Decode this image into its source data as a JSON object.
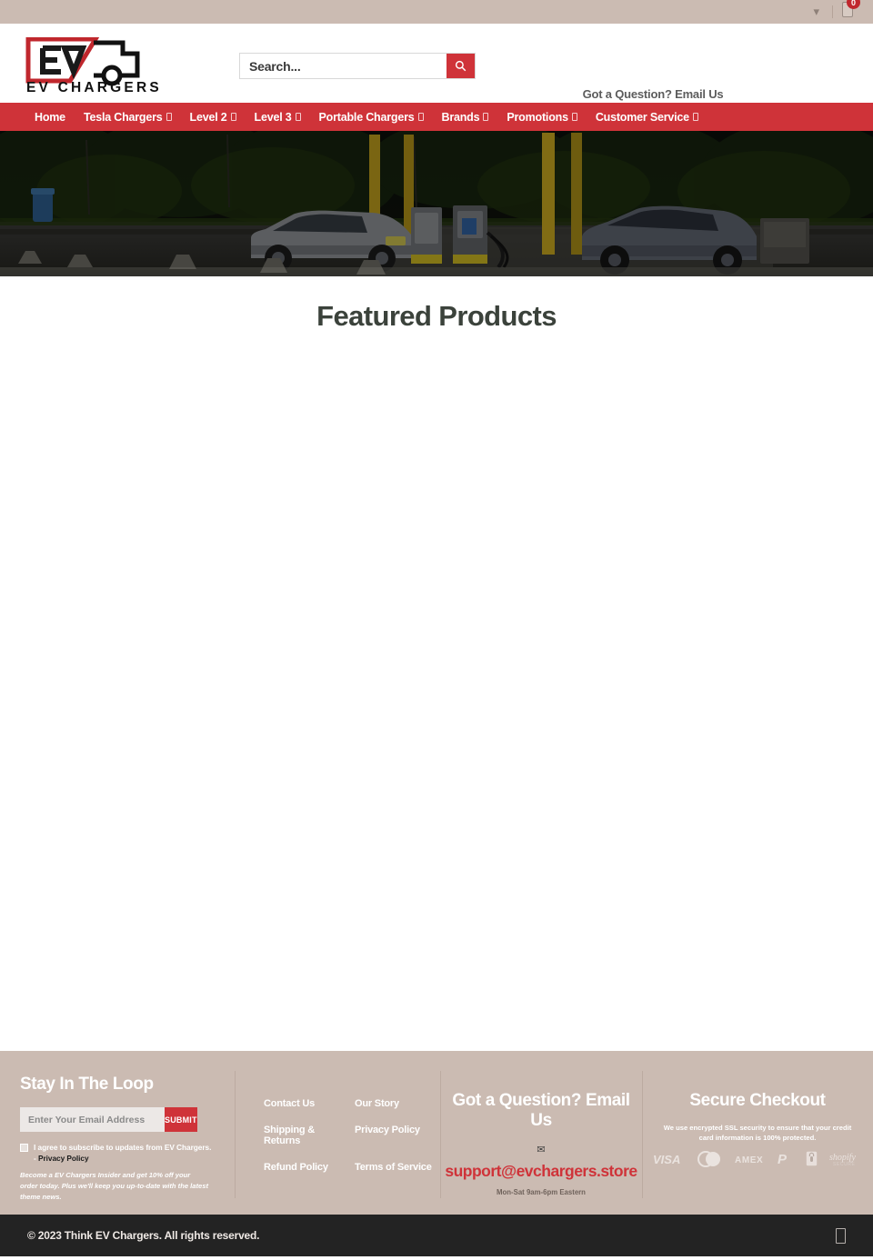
{
  "topbar": {
    "chevron_icon": "chevron-down-icon",
    "cart_icon": "shopping-cart-icon",
    "cart_count": "0"
  },
  "header": {
    "logo": {
      "icon": "ev-truck-logo-icon",
      "mark_text": "EV",
      "wordmark": "EV CHARGERS"
    },
    "search": {
      "placeholder": "Search...",
      "value": "",
      "button_icon": "search-icon"
    },
    "contact": {
      "question": "Got a Question? Email Us",
      "email_icon": "envelope-icon",
      "email": "support@evchargers.store",
      "hours": "Mon-Sat 9am-6pm Eastern"
    }
  },
  "nav": {
    "items": [
      {
        "label": "Home",
        "has_dropdown": false
      },
      {
        "label": "Tesla Chargers",
        "has_dropdown": true
      },
      {
        "label": "Level 2",
        "has_dropdown": true
      },
      {
        "label": "Level 3",
        "has_dropdown": true
      },
      {
        "label": "Portable Chargers",
        "has_dropdown": true
      },
      {
        "label": "Brands",
        "has_dropdown": true
      },
      {
        "label": "Promotions",
        "has_dropdown": true
      },
      {
        "label": "Customer Service",
        "has_dropdown": true
      }
    ]
  },
  "hero": {
    "alt": "EV charging station at night with two cars plugged into chargers"
  },
  "main": {
    "featured_title": "Featured Products"
  },
  "footer": {
    "newsletter": {
      "heading": "Stay In The Loop",
      "email_placeholder": "Enter Your Email Address",
      "email_value": "",
      "submit_label": "SUBMIT",
      "agree_text": "I agree to subscribe to updates from EV Chargers. -",
      "agree_link": "Privacy Policy",
      "promo_note": "Become a EV Chargers Insider and get 10% off your order today. Plus we'll keep you up-to-date with the latest theme news."
    },
    "links": [
      "Contact Us",
      "Our Story",
      "Shipping & Returns",
      "Privacy Policy",
      "Refund Policy",
      "Terms of Service"
    ],
    "support": {
      "heading": "Got a Question? Email Us",
      "email_icon": "envelope-icon",
      "email": "support@evchargers.store",
      "hours": "Mon-Sat 9am-6pm Eastern"
    },
    "secure": {
      "heading": "Secure Checkout",
      "note": "We use encrypted SSL security to ensure that your credit card information is 100% protected.",
      "payment_icons": [
        "visa-icon",
        "mastercard-icon",
        "amex-icon",
        "paypal-icon",
        "lock-icon",
        "shopify-secure-icon"
      ],
      "payment_labels": [
        "VISA",
        "",
        "AMEX",
        "P",
        "",
        "shopify"
      ]
    }
  },
  "copyright": {
    "text": "© 2023 Think EV Chargers. All rights reserved.",
    "social_icon": "facebook-icon"
  },
  "colors": {
    "brand_red": "#cf3339",
    "beige": "#cbbbb2",
    "dark": "#232323",
    "heading": "#3b423b"
  }
}
